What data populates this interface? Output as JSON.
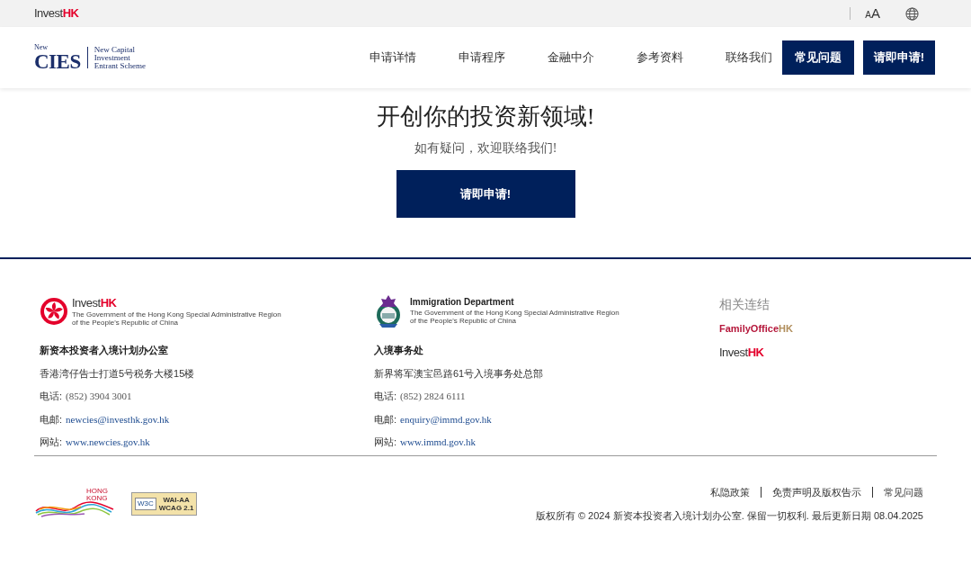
{
  "top_bar": {
    "logo": {
      "text": "Invest",
      "accent": "HK"
    },
    "font_size": {
      "small": "A",
      "large": "A"
    }
  },
  "header": {
    "logo": {
      "prefix": "New",
      "name": "CIES",
      "tagline": [
        "New Capital",
        "Investment",
        "Entrant Scheme"
      ]
    },
    "nav": [
      "申请详情",
      "申请程序",
      "金融中介",
      "参考资料",
      "联络我们"
    ],
    "buttons": [
      "常见问题",
      "请即申请!"
    ]
  },
  "hero": {
    "title": "开创你的投资新领域!",
    "subtitle": "如有疑问，欢迎联络我们!",
    "button": "请即申请!"
  },
  "footer": {
    "contacts": [
      {
        "kind": "investhk",
        "logo": {
          "text": "Invest",
          "accent": "HK",
          "caption": [
            "The Government of the Hong Kong Special Administrative Region",
            "of the People's Republic of China"
          ]
        },
        "name": "新资本投资者入境计划办公室",
        "address": "香港湾仔告士打道5号税务大楼15楼",
        "phone_label": "电话:",
        "phone": "(852) 3904 3001",
        "email_label": "电邮:",
        "email": "newcies@investhk.gov.hk",
        "web_label": "网站:",
        "web": "www.newcies.gov.hk"
      },
      {
        "kind": "immigration",
        "logo": {
          "text": "Immigration Department",
          "caption": [
            "The Government of the Hong Kong Special Administrative Region",
            "of the People's Republic of China"
          ]
        },
        "name": "入境事务处",
        "address": "新界将军澳宝邑路61号入境事务处总部",
        "phone_label": "电话:",
        "phone": "(852) 2824 6111",
        "email_label": "电邮:",
        "email": "enquiry@immd.gov.hk",
        "web_label": "网站:",
        "web": "www.immd.gov.hk"
      }
    ],
    "related": {
      "title": "相关连结",
      "links": [
        {
          "text": "FamilyOffice",
          "accent": "HK"
        },
        {
          "text": "Invest",
          "accent": "HK"
        }
      ]
    },
    "badges": {
      "brand": [
        "HONG",
        "KONG"
      ],
      "w3c": "W3C",
      "wai": "WAI-AA",
      "wcag": "WCAG 2.1"
    },
    "links": [
      "私隐政策",
      "免责声明及版权告示",
      "常见问题"
    ],
    "copyright": "版权所有 © 2024 新资本投资者入境计划办公室. 保留一切权利. 最后更新日期 08.04.2025"
  }
}
